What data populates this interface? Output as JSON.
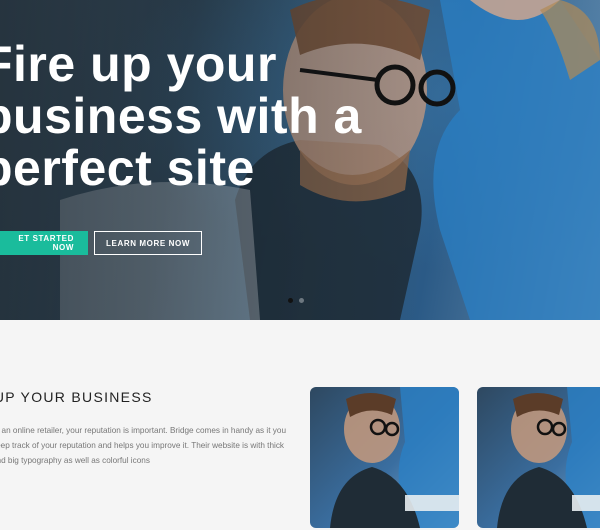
{
  "hero": {
    "title_lines": [
      "Fire up your",
      "business with a",
      "perfect site"
    ],
    "primary_button": "ET STARTED NOW",
    "secondary_button": "LEARN MORE NOW",
    "slider": {
      "slide_count": 2,
      "active_slide": 1
    }
  },
  "section": {
    "title": "E UP YOUR BUSINESS",
    "text": "re an online retailer, your reputation is important. Bridge comes in handy as it you keep track of your reputation and helps you improve it. Their website is with thick and big typography as well as colorful icons"
  },
  "colors": {
    "accent": "#1abc9c",
    "hero_overlay": "#2f4556",
    "page_bg": "#f5f5f5"
  }
}
